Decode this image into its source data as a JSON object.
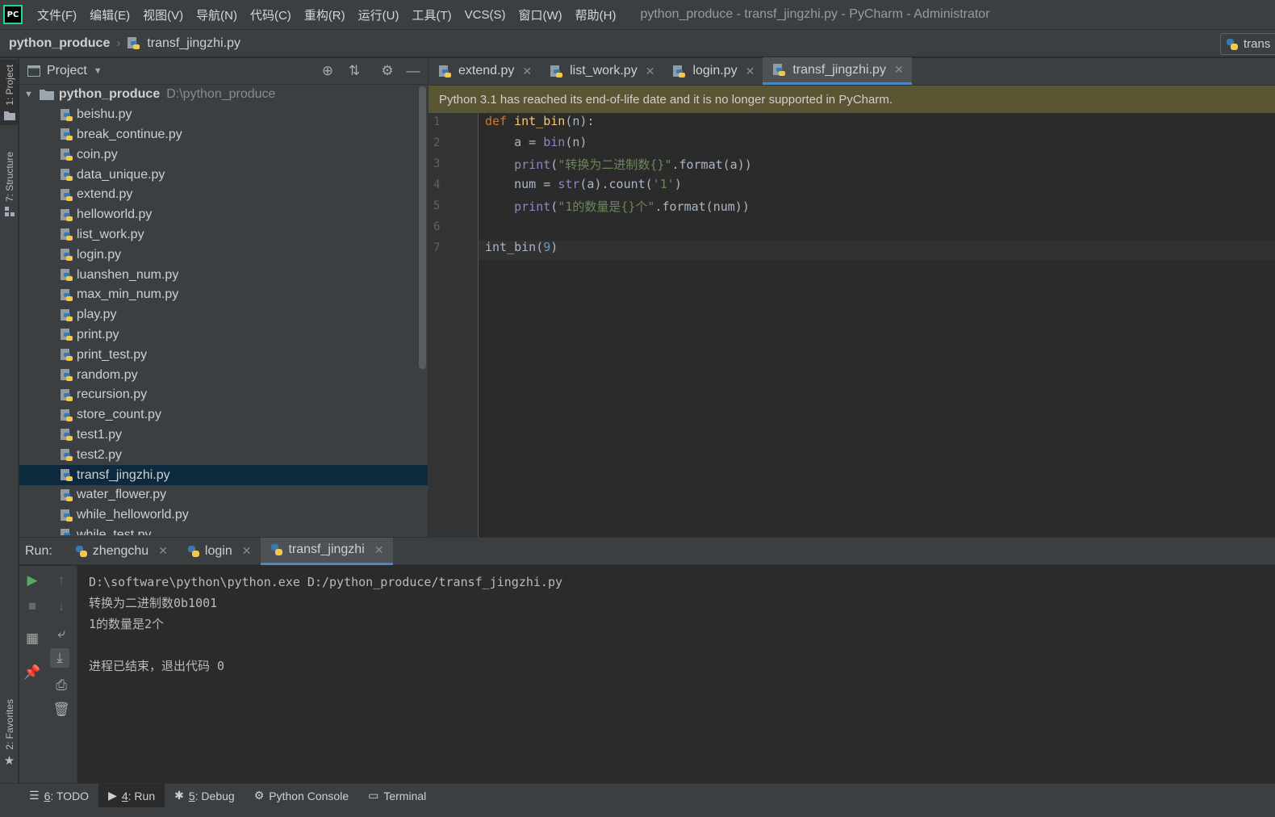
{
  "app": {
    "logo_text": "PC",
    "window_title": "python_produce - transf_jingzhi.py - PyCharm - Administrator"
  },
  "menu": [
    "文件(F)",
    "编辑(E)",
    "视图(V)",
    "导航(N)",
    "代码(C)",
    "重构(R)",
    "运行(U)",
    "工具(T)",
    "VCS(S)",
    "窗口(W)",
    "帮助(H)"
  ],
  "breadcrumb": {
    "project": "python_produce",
    "file": "transf_jingzhi.py",
    "run_config": "trans"
  },
  "left_tools": {
    "project": "1: Project",
    "structure": "7: Structure",
    "favorites": "2: Favorites"
  },
  "project_panel": {
    "title": "Project",
    "root_name": "python_produce",
    "root_path": "D:\\python_produce",
    "files": [
      "beishu.py",
      "break_continue.py",
      "coin.py",
      "data_unique.py",
      "extend.py",
      "helloworld.py",
      "list_work.py",
      "login.py",
      "luanshen_num.py",
      "max_min_num.py",
      "play.py",
      "print.py",
      "print_test.py",
      "random.py",
      "recursion.py",
      "store_count.py",
      "test1.py",
      "test2.py",
      "transf_jingzhi.py",
      "water_flower.py",
      "while_helloworld.py",
      "while_test.py"
    ],
    "selected": "transf_jingzhi.py"
  },
  "editor": {
    "tabs": [
      "extend.py",
      "list_work.py",
      "login.py",
      "transf_jingzhi.py"
    ],
    "active_tab": "transf_jingzhi.py",
    "banner": "Python 3.1 has reached its end-of-life date and it is no longer supported in PyCharm.",
    "line_numbers": [
      "1",
      "2",
      "3",
      "4",
      "5",
      "6",
      "7"
    ],
    "code": [
      "def int_bin(n):",
      "    a = bin(n)",
      "    print(\"转换为二进制数{}\".format(a))",
      "    num = str(a).count('1')",
      "    print(\"1的数量是{}个\".format(num))",
      "",
      "int_bin(9)"
    ]
  },
  "run": {
    "label": "Run:",
    "tabs": [
      "zhengchu",
      "login",
      "transf_jingzhi"
    ],
    "active_tab": "transf_jingzhi",
    "console": [
      "D:\\software\\python\\python.exe D:/python_produce/transf_jingzhi.py",
      "转换为二进制数0b1001",
      "1的数量是2个",
      "",
      "进程已结束，退出代码 0"
    ]
  },
  "statusbar": [
    {
      "num": "6",
      "label": ": TODO"
    },
    {
      "num": "4",
      "label": ": Run"
    },
    {
      "num": "5",
      "label": ": Debug"
    },
    {
      "num": "",
      "label": "Python Console"
    },
    {
      "num": "",
      "label": "Terminal"
    }
  ],
  "colors": {
    "accent": "#4a88c7",
    "keyword": "#cc7832",
    "function": "#ffc66d",
    "builtin": "#8888c6",
    "string": "#6a8759",
    "number": "#6897bb",
    "banner": "#5a5634",
    "selection": "#0d293e"
  }
}
